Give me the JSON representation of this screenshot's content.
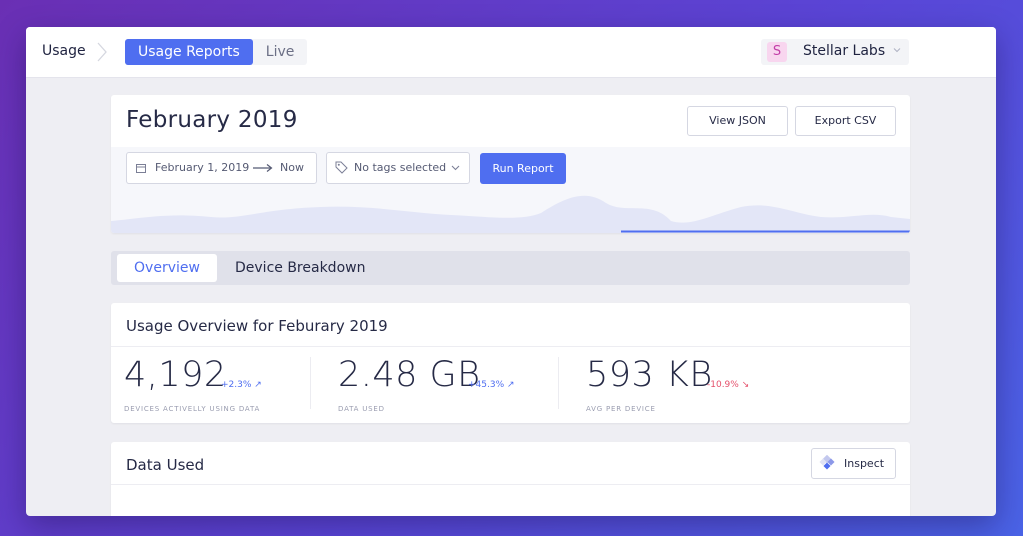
{
  "topbar": {
    "breadcrumb": "Usage",
    "tabs": [
      {
        "label": "Usage Reports",
        "active": true
      },
      {
        "label": "Live",
        "active": false
      }
    ],
    "org": {
      "initial": "S",
      "name": "Stellar Labs"
    }
  },
  "report": {
    "title": "February 2019",
    "view_json_label": "View JSON",
    "export_csv_label": "Export CSV",
    "date_from": "February 1, 2019",
    "date_to": "Now",
    "tags_placeholder": "No tags selected",
    "run_label": "Run Report"
  },
  "tabs": [
    {
      "label": "Overview",
      "active": true
    },
    {
      "label": "Device Breakdown",
      "active": false
    }
  ],
  "overview": {
    "title": "Usage Overview for Feburary 2019",
    "stats": [
      {
        "value": "4,192",
        "change": "+2.3% ↗",
        "label": "DEVICES ACTIVELLY USING DATA"
      },
      {
        "value": "2.48 GB",
        "change": "+45.3% ↗",
        "label": "DATA USED"
      },
      {
        "value": "593 KB",
        "change": "-10.9% ↘",
        "label": "AVG PER DEVICE"
      }
    ]
  },
  "data_used": {
    "title": "Data Used",
    "inspect_label": "Inspect"
  },
  "colors": {
    "accent": "#4f6ef0",
    "positive": "#4f6ef0",
    "negative": "#e5506b"
  }
}
